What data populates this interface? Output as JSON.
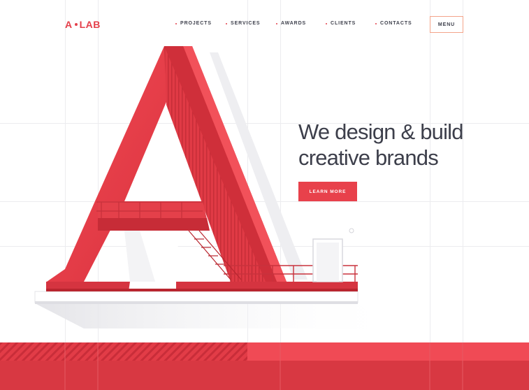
{
  "header": {
    "logo": {
      "left": "A",
      "right": "LAB"
    },
    "nav": [
      {
        "label": "PROJECTS"
      },
      {
        "label": "SERVICES"
      },
      {
        "label": "AWARDS"
      },
      {
        "label": "CLIENTS"
      },
      {
        "label": "CONTACTS"
      }
    ],
    "menu_label": "MENU"
  },
  "hero": {
    "headline_line1": "We design & build",
    "headline_line2": "creative brands",
    "cta_label": "LEARN MORE"
  },
  "colors": {
    "brand_red": "#e8414b",
    "text_dark": "#3d3f4b",
    "menu_border": "#f4a48a",
    "grid": "#ececef"
  },
  "icons": {
    "logo_separator": "dot-icon",
    "nav_bullet": "bullet-icon"
  }
}
